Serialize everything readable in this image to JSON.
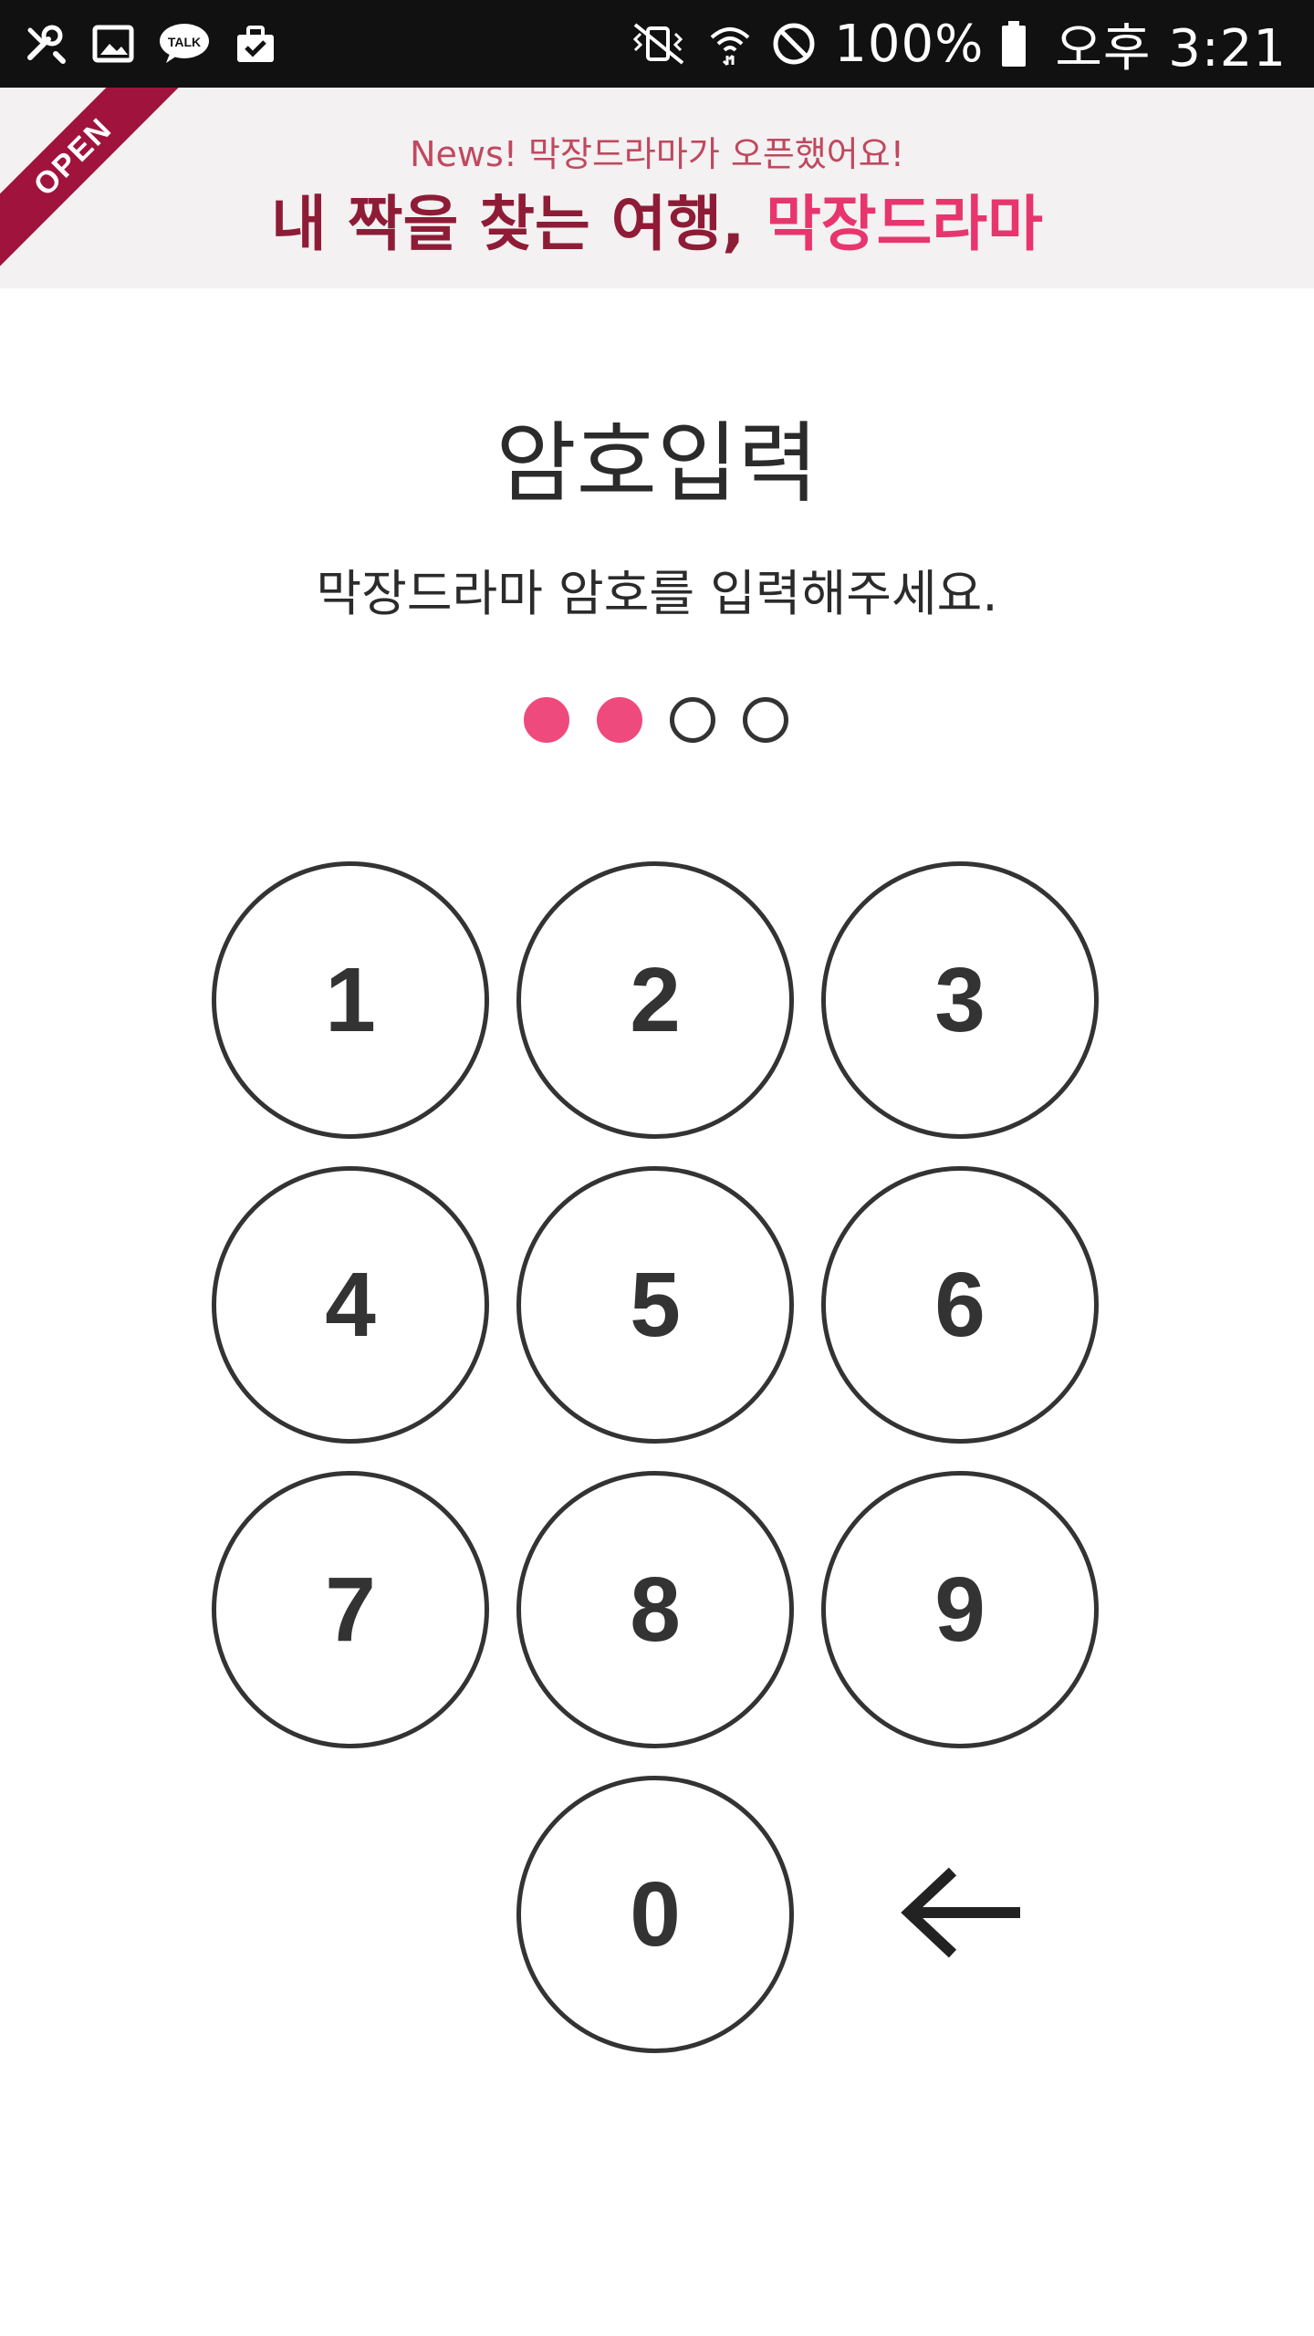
{
  "status_bar": {
    "left_icons": [
      "tools-icon",
      "gallery-icon",
      "kakaotalk-icon",
      "briefcase-icon"
    ],
    "kakao_label": "TALK",
    "battery_percent": "100%",
    "time": "오후 3:21"
  },
  "banner": {
    "ribbon": "OPEN",
    "news": "News! 막장드라마가 오픈했어요!",
    "title_main": "내 짝을 찾는 여행,",
    "title_accent": "막장드라마"
  },
  "screen": {
    "title": "암호입력",
    "subtitle": "막장드라마 암호를 입력해주세요."
  },
  "pin": {
    "length": 4,
    "filled": 2
  },
  "keypad": {
    "keys": [
      "1",
      "2",
      "3",
      "4",
      "5",
      "6",
      "7",
      "8",
      "9",
      "0"
    ],
    "backspace_icon": "arrow-left-icon"
  },
  "colors": {
    "accent": "#ef4a7d",
    "banner_title": "#8e1c37",
    "ribbon": "#a0133d",
    "text": "#333333"
  }
}
